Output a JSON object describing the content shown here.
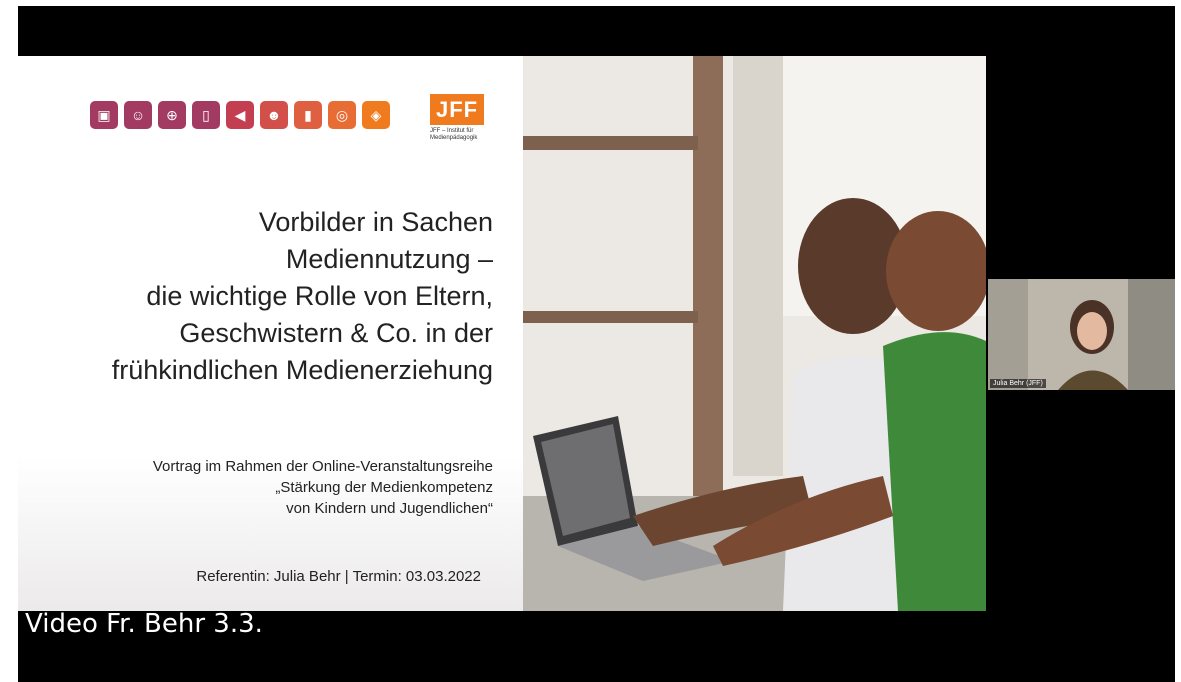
{
  "slide": {
    "logo_icons": [
      {
        "icon": "photo-speech-icon",
        "color": "#a33a62"
      },
      {
        "icon": "people-icon",
        "color": "#a33a62"
      },
      {
        "icon": "gamepad-icon",
        "color": "#a33a62"
      },
      {
        "icon": "tablet-icon",
        "color": "#a33a62"
      },
      {
        "icon": "megaphone-icon",
        "color": "#c43e52"
      },
      {
        "icon": "group-icon",
        "color": "#d24f4a"
      },
      {
        "icon": "phone-icon",
        "color": "#de6040"
      },
      {
        "icon": "globe-icon",
        "color": "#e86d34"
      },
      {
        "icon": "compass-icon",
        "color": "#f07a1e"
      }
    ],
    "logo_text": "JFF",
    "logo_subtitle_line1": "JFF – Institut für",
    "logo_subtitle_line2": "Medienpädagogik",
    "title_lines": [
      "Vorbilder in Sachen",
      "Mediennutzung –",
      "die wichtige Rolle von Eltern,",
      "Geschwistern & Co. in der",
      "frühkindlichen Medienerziehung"
    ],
    "subtitle_lines": [
      "Vortrag im Rahmen der Online-Veranstaltungsreihe",
      "„Stärkung der Medienkompetenz",
      "von Kindern und Jugendlichen“"
    ],
    "presenter_line": "Referentin: Julia Behr | Termin: 03.03.2022",
    "photo_description_icon": "father-child-laptop-photo"
  },
  "participant": {
    "name": "Julia Behr (JFF)"
  },
  "caption": "Video Fr. Behr 3.3.",
  "colors": {
    "frame_bg": "#000000",
    "logo_orange": "#f07a1e",
    "logo_magenta": "#a33a62"
  }
}
